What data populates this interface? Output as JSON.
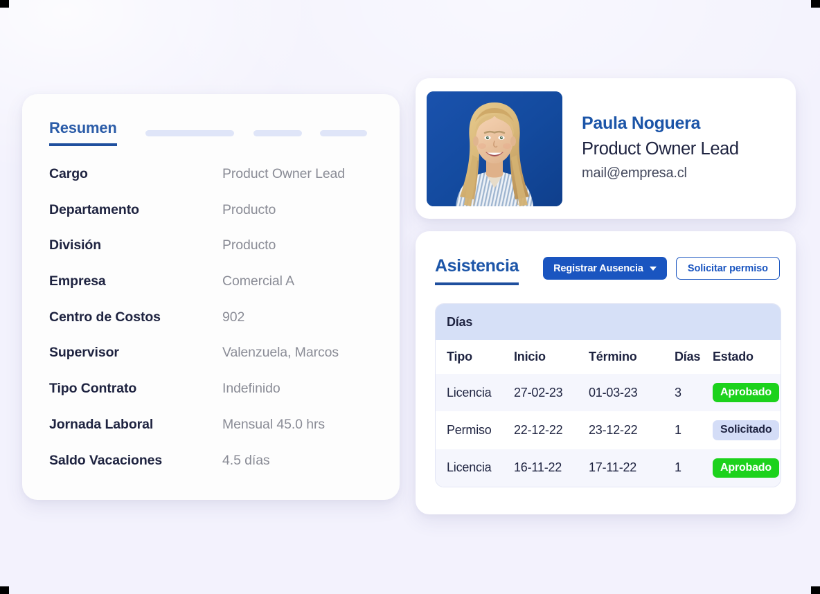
{
  "theme": {
    "background": "#f3f2fd",
    "card_background": "#ffffff",
    "accent_blue": "#1a55c0",
    "tab_blue": "#2b5ca8",
    "label_navy": "#1e2340",
    "value_gray": "#8a8c96",
    "badge_green": "#1cd21c",
    "badge_lavender": "#d4ddf7",
    "band_blue": "#d6e0f7",
    "skeleton_blue": "#dfe5f8",
    "photo_background": "#1a4fa0"
  },
  "summary_card": {
    "tabs": [
      {
        "label": "Resumen",
        "active": true
      },
      {
        "label": "",
        "active": false,
        "skeleton_width": 128
      },
      {
        "label": "",
        "active": false,
        "skeleton_width": 70
      },
      {
        "label": "",
        "active": false,
        "skeleton_width": 68
      }
    ],
    "details": [
      {
        "label": "Cargo",
        "value": "Product Owner Lead"
      },
      {
        "label": "Departamento",
        "value": "Producto"
      },
      {
        "label": "División",
        "value": "Producto"
      },
      {
        "label": "Empresa",
        "value": "Comercial A"
      },
      {
        "label": "Centro de Costos",
        "value": "902"
      },
      {
        "label": "Supervisor",
        "value": "Valenzuela, Marcos"
      },
      {
        "label": "Tipo Contrato",
        "value": "Indefinido"
      },
      {
        "label": "Jornada Laboral",
        "value": "Mensual 45.0 hrs"
      },
      {
        "label": "Saldo Vacaciones",
        "value": "4.5 días"
      }
    ]
  },
  "profile_card": {
    "avatar_icon": "employee-photo",
    "name": "Paula Noguera",
    "title": "Product Owner Lead",
    "email": "mail@empresa.cl"
  },
  "attendance_card": {
    "title": "Asistencia",
    "buttons": {
      "primary_label": "Registrar Ausencia",
      "primary_caret_icon": "chevron-down-icon",
      "secondary_label": "Solicitar permiso"
    },
    "table": {
      "section_title": "Días",
      "columns": [
        "Tipo",
        "Inicio",
        "Término",
        "Días",
        "Estado"
      ],
      "rows": [
        {
          "tipo": "Licencia",
          "inicio": "27-02-23",
          "termino": "01-03-23",
          "dias": "3",
          "estado": "Aprobado",
          "estado_style": "approved"
        },
        {
          "tipo": "Permiso",
          "inicio": "22-12-22",
          "termino": "23-12-22",
          "dias": "1",
          "estado": "Solicitado",
          "estado_style": "requested"
        },
        {
          "tipo": "Licencia",
          "inicio": "16-11-22",
          "termino": "17-11-22",
          "dias": "1",
          "estado": "Aprobado",
          "estado_style": "approved"
        }
      ]
    }
  }
}
